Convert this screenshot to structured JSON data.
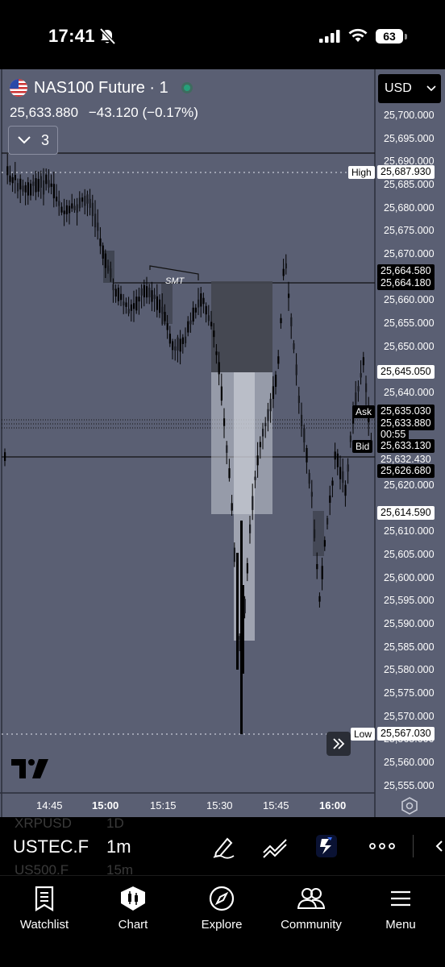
{
  "status": {
    "time": "17:41",
    "battery": "63"
  },
  "header": {
    "symbol": "NAS100 Future · 1",
    "last_price": "25,633.880",
    "change": "−43.120 (−0.17%)",
    "collapse_count": "3",
    "currency": "USD"
  },
  "price_axis": [
    "25,700.000",
    "25,695.000",
    "25,690.000",
    "25,685.000",
    "25,680.000",
    "25,675.000",
    "25,670.000",
    "25,660.000",
    "25,655.000",
    "25,650.000",
    "25,640.000",
    "25,620.000",
    "25,610.000",
    "25,605.000",
    "25,600.000",
    "25,595.000",
    "25,590.000",
    "25,585.000",
    "25,580.000",
    "25,575.000",
    "25,570.000",
    "25,565.000",
    "25,560.000",
    "25,555.000"
  ],
  "tags": {
    "high_label": "High",
    "high_value": "25,687.930",
    "level1": "25,664.580",
    "level2": "25,664.180",
    "level3": "25,645.050",
    "ask_label": "Ask",
    "ask_value": "25,635.030",
    "last": "25,633.880",
    "countdown": "00:55",
    "bid_label": "Bid",
    "bid_value": "25,633.130",
    "level4": "25,632.430",
    "level5": "25,626.680",
    "level6": "25,614.590",
    "low_label": "Low",
    "low_value": "25,567.030"
  },
  "annotation": "SMT",
  "time_axis": [
    "14:45",
    "15:00",
    "15:15",
    "15:30",
    "15:45",
    "16:00"
  ],
  "toolbar": {
    "symbol": "USTEC.F",
    "interval": "1m",
    "ghost_top_symbol": "XRPUSD",
    "ghost_top_interval": "1D",
    "ghost_bottom_symbol": "US500.F",
    "ghost_bottom_interval": "15m"
  },
  "nav": [
    {
      "label": "Watchlist",
      "icon": "watchlist-icon"
    },
    {
      "label": "Chart",
      "icon": "chart-icon"
    },
    {
      "label": "Explore",
      "icon": "compass-icon"
    },
    {
      "label": "Community",
      "icon": "community-icon"
    },
    {
      "label": "Menu",
      "icon": "menu-icon"
    }
  ],
  "colors": {
    "chart_bg": "#5a5f73",
    "accent_green": "#26a07a"
  }
}
